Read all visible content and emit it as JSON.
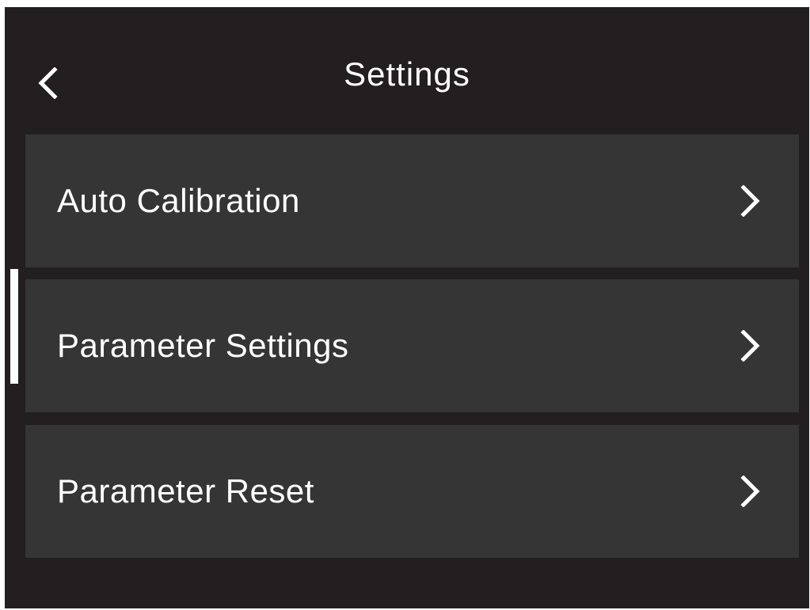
{
  "header": {
    "title": "Settings",
    "back_icon": "chevron-left-icon"
  },
  "menu": {
    "items": [
      {
        "label": "Auto Calibration",
        "icon": "chevron-right-icon"
      },
      {
        "label": "Parameter Settings",
        "icon": "chevron-right-icon",
        "selected": true
      },
      {
        "label": "Parameter Reset",
        "icon": "chevron-right-icon"
      }
    ]
  },
  "colors": {
    "background": "#231f20",
    "item_background": "#353535",
    "text": "#ffffff",
    "indicator": "#ffffff"
  }
}
